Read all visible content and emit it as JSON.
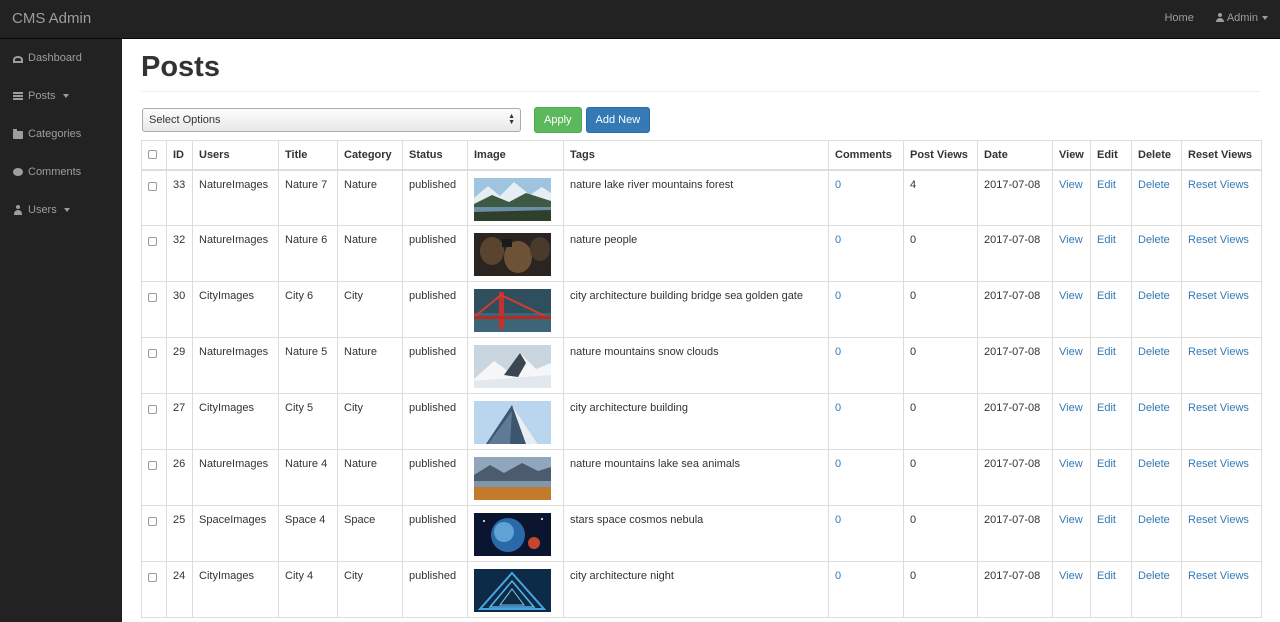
{
  "app": {
    "brand": "CMS Admin",
    "nav_home": "Home",
    "nav_user": "Admin"
  },
  "sidebar": {
    "items": [
      {
        "label": "Dashboard",
        "icon": "dashboard-icon"
      },
      {
        "label": "Posts",
        "icon": "list-icon",
        "dropdown": true
      },
      {
        "label": "Categories",
        "icon": "folder-icon"
      },
      {
        "label": "Comments",
        "icon": "comment-icon"
      },
      {
        "label": "Users",
        "icon": "user-icon",
        "dropdown": true
      }
    ]
  },
  "page": {
    "title": "Posts",
    "select_value": "Select Options",
    "apply_label": "Apply",
    "add_new_label": "Add New"
  },
  "table": {
    "headers": [
      "ID",
      "Users",
      "Title",
      "Category",
      "Status",
      "Image",
      "Tags",
      "Comments",
      "Post Views",
      "Date",
      "View",
      "Edit",
      "Delete",
      "Reset Views"
    ],
    "rows": [
      {
        "id": "33",
        "user": "NatureImages",
        "title": "Nature 7",
        "category": "Nature",
        "status": "published",
        "image": "lake-mountains",
        "tags": "nature lake river mountains forest",
        "comments": "0",
        "views": "4",
        "date": "2017-07-08",
        "view": "View",
        "edit": "Edit",
        "delete": "Delete",
        "reset": "Reset Views"
      },
      {
        "id": "32",
        "user": "NatureImages",
        "title": "Nature 6",
        "category": "Nature",
        "status": "published",
        "image": "people",
        "tags": "nature people",
        "comments": "0",
        "views": "0",
        "date": "2017-07-08",
        "view": "View",
        "edit": "Edit",
        "delete": "Delete",
        "reset": "Reset Views"
      },
      {
        "id": "30",
        "user": "CityImages",
        "title": "City 6",
        "category": "City",
        "status": "published",
        "image": "golden-gate",
        "tags": "city architecture building bridge sea golden gate",
        "comments": "0",
        "views": "0",
        "date": "2017-07-08",
        "view": "View",
        "edit": "Edit",
        "delete": "Delete",
        "reset": "Reset Views"
      },
      {
        "id": "29",
        "user": "NatureImages",
        "title": "Nature 5",
        "category": "Nature",
        "status": "published",
        "image": "snow-mountains",
        "tags": "nature mountains snow clouds",
        "comments": "0",
        "views": "0",
        "date": "2017-07-08",
        "view": "View",
        "edit": "Edit",
        "delete": "Delete",
        "reset": "Reset Views"
      },
      {
        "id": "27",
        "user": "CityImages",
        "title": "City 5",
        "category": "City",
        "status": "published",
        "image": "building",
        "tags": "city architecture building",
        "comments": "0",
        "views": "0",
        "date": "2017-07-08",
        "view": "View",
        "edit": "Edit",
        "delete": "Delete",
        "reset": "Reset Views"
      },
      {
        "id": "26",
        "user": "NatureImages",
        "title": "Nature 4",
        "category": "Nature",
        "status": "published",
        "image": "lake-sea",
        "tags": "nature mountains lake sea animals",
        "comments": "0",
        "views": "0",
        "date": "2017-07-08",
        "view": "View",
        "edit": "Edit",
        "delete": "Delete",
        "reset": "Reset Views"
      },
      {
        "id": "25",
        "user": "SpaceImages",
        "title": "Space 4",
        "category": "Space",
        "status": "published",
        "image": "nebula",
        "tags": "stars space cosmos nebula",
        "comments": "0",
        "views": "0",
        "date": "2017-07-08",
        "view": "View",
        "edit": "Edit",
        "delete": "Delete",
        "reset": "Reset Views"
      },
      {
        "id": "24",
        "user": "CityImages",
        "title": "City 4",
        "category": "City",
        "status": "published",
        "image": "night-tunnel",
        "tags": "city architecture night",
        "comments": "0",
        "views": "0",
        "date": "2017-07-08",
        "view": "View",
        "edit": "Edit",
        "delete": "Delete",
        "reset": "Reset Views"
      }
    ]
  },
  "colors": {
    "link": "#337ab7",
    "apply": "#5cb85c",
    "add_new": "#337ab7",
    "nav_bg": "#222222"
  }
}
